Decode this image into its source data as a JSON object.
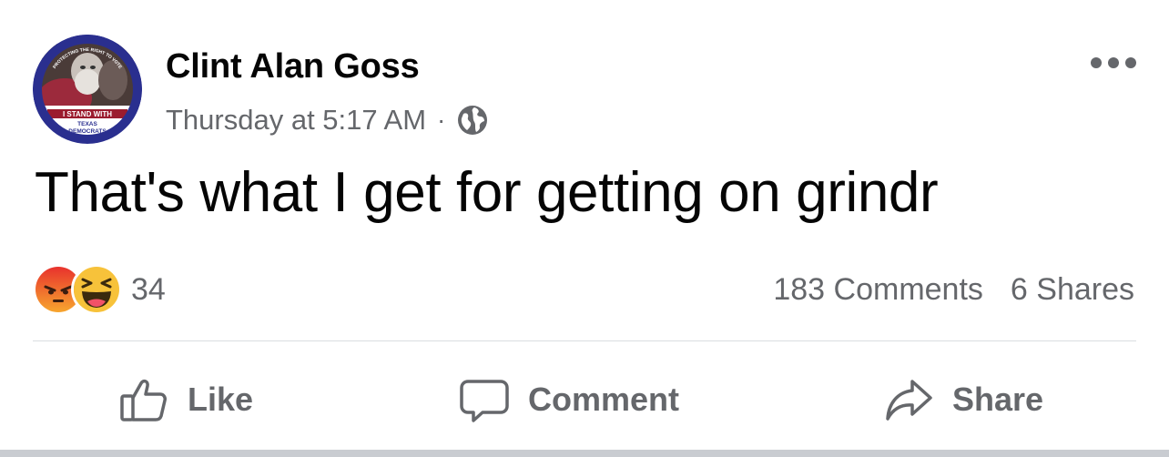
{
  "post": {
    "author": "Clint Alan Goss",
    "timestamp": "Thursday at 5:17 AM",
    "separator": "·",
    "privacy_icon": "globe-icon",
    "menu_icon": "more-options-icon",
    "text": "That's what I get for getting on grindr",
    "avatar": {
      "frame_top_text": "PROTECTING THE RIGHT TO VOTE",
      "banner_text": "I STAND WITH",
      "bottom_line1": "TEXAS",
      "bottom_line2": "DEMOCRATS",
      "frame_color": "#2a2f8f"
    }
  },
  "reactions": {
    "icons": [
      "angry-reaction-icon",
      "haha-reaction-icon"
    ],
    "count": "34"
  },
  "stats": {
    "comments": "183 Comments",
    "shares": "6 Shares"
  },
  "actions": {
    "like": "Like",
    "comment": "Comment",
    "share": "Share"
  },
  "colors": {
    "text_primary": "#050505",
    "text_secondary": "#65676b",
    "divider": "#dadde1",
    "angry": "#f0522b",
    "haha": "#f7c23a"
  }
}
